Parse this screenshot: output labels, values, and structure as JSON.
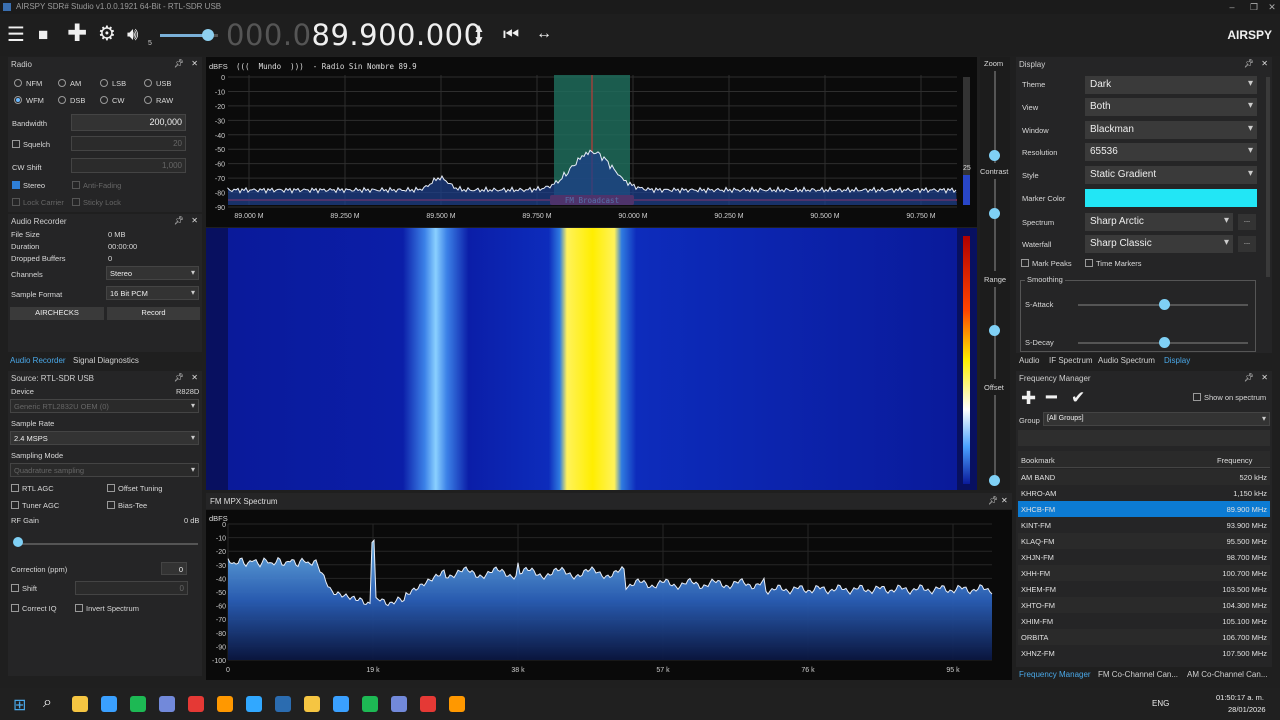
{
  "window": {
    "title": "AIRSPY SDR# Studio v1.0.0.1921 64-Bit - RTL-SDR USB",
    "minimize": "–",
    "maximize": "❐",
    "close": "✕"
  },
  "toolbar": {
    "frequency_dim": "000.0",
    "frequency_bright": "89.900.000",
    "volume_suffix": "5",
    "logo": "AIRSPY"
  },
  "radio": {
    "header": "Radio",
    "modes": [
      "NFM",
      "AM",
      "LSB",
      "USB",
      "WFM",
      "DSB",
      "CW",
      "RAW"
    ],
    "selected_mode": "WFM",
    "bandwidth_label": "Bandwidth",
    "bandwidth_value": "200,000",
    "squelch_label": "Squelch",
    "squelch_value": "20",
    "cw_shift_label": "CW Shift",
    "cw_shift_value": "1,000",
    "stereo_label": "Stereo",
    "anti_fading_label": "Anti-Fading",
    "lock_carrier_label": "Lock Carrier",
    "sticky_lock_label": "Sticky Lock"
  },
  "audio_recorder": {
    "header": "Audio Recorder",
    "file_size_label": "File Size",
    "file_size_value": "0 MB",
    "duration_label": "Duration",
    "duration_value": "00:00:00",
    "dropped_label": "Dropped Buffers",
    "dropped_value": "0",
    "channels_label": "Channels",
    "channels_value": "Stereo",
    "format_label": "Sample Format",
    "format_value": "16 Bit PCM",
    "airchecks_button": "AIRCHECKS",
    "record_button": "Record"
  },
  "left_tabs": {
    "tab1": "Audio Recorder",
    "tab2": "Signal Diagnostics"
  },
  "source": {
    "header": "Source: RTL-SDR USB",
    "device_label": "Device",
    "device_tuner": "R828D",
    "device_value": "Generic RTL2832U OEM (0)",
    "sample_rate_label": "Sample Rate",
    "sample_rate_value": "2.4 MSPS",
    "sampling_mode_label": "Sampling Mode",
    "sampling_mode_value": "Quadrature sampling",
    "rtl_agc": "RTL AGC",
    "offset_tuning": "Offset Tuning",
    "tuner_agc": "Tuner AGC",
    "bias_tee": "Bias-Tee",
    "rf_gain_label": "RF Gain",
    "rf_gain_value": "0 dB",
    "correction_label": "Correction (ppm)",
    "correction_value": "0",
    "shift_label": "Shift",
    "shift_value": "0",
    "correct_iq": "Correct IQ",
    "invert_spectrum": "Invert Spectrum"
  },
  "spectrum": {
    "unit": "dBFS",
    "station_text": "(((  Mundo  )))  - Radio Sin Nombre 89.9",
    "y_ticks": [
      "0",
      "-10",
      "-20",
      "-30",
      "-40",
      "-50",
      "-60",
      "-70",
      "-80",
      "-90"
    ],
    "x_ticks": [
      "89.000 M",
      "89.250 M",
      "89.500 M",
      "89.750 M",
      "90.000 M",
      "90.250 M",
      "90.500 M",
      "90.750 M"
    ],
    "band_label": "FM Broadcast",
    "side_value": "25"
  },
  "side_controls": {
    "zoom": "Zoom",
    "contrast": "Contrast",
    "range": "Range",
    "offset": "Offset"
  },
  "mpx": {
    "header": "FM MPX Spectrum",
    "unit": "dBFS",
    "y_ticks": [
      "0",
      "-10",
      "-20",
      "-30",
      "-40",
      "-50",
      "-60",
      "-70",
      "-80",
      "-90",
      "-100"
    ],
    "x_ticks": [
      "0",
      "19 k",
      "38 k",
      "57 k",
      "76 k",
      "95 k"
    ]
  },
  "display": {
    "header": "Display",
    "theme_label": "Theme",
    "theme_value": "Dark",
    "view_label": "View",
    "view_value": "Both",
    "window_label": "Window",
    "window_value": "Blackman",
    "resolution_label": "Resolution",
    "resolution_value": "65536",
    "style_label": "Style",
    "style_value": "Static Gradient",
    "marker_color_label": "Marker Color",
    "marker_color": "#22e6f5",
    "spectrum_label": "Spectrum",
    "spectrum_value": "Sharp Arctic",
    "waterfall_label": "Waterfall",
    "waterfall_value": "Sharp Classic",
    "mark_peaks": "Mark Peaks",
    "time_markers": "Time Markers",
    "smoothing": "Smoothing",
    "s_attack": "S-Attack",
    "s_decay": "S-Decay",
    "more": "..."
  },
  "right_tabs": {
    "audio": "Audio",
    "if": "IF Spectrum",
    "audio_spectrum": "Audio Spectrum",
    "display": "Display"
  },
  "freq_manager": {
    "header": "Frequency Manager",
    "show_on_spectrum": "Show on spectrum",
    "group_label": "Group",
    "group_value": "[All Groups]",
    "col_bookmark": "Bookmark",
    "col_frequency": "Frequency",
    "rows": [
      {
        "name": "AM BAND",
        "freq": "520 kHz"
      },
      {
        "name": "KHRO-AM",
        "freq": "1,150 kHz"
      },
      {
        "name": "XHCB-FM",
        "freq": "89.900 MHz"
      },
      {
        "name": "KINT-FM",
        "freq": "93.900 MHz"
      },
      {
        "name": "KLAQ-FM",
        "freq": "95.500 MHz"
      },
      {
        "name": "XHJN-FM",
        "freq": "98.700 MHz"
      },
      {
        "name": "XHH-FM",
        "freq": "100.700 MHz"
      },
      {
        "name": "XHEM-FM",
        "freq": "103.500 MHz"
      },
      {
        "name": "XHTO-FM",
        "freq": "104.300 MHz"
      },
      {
        "name": "XHIM-FM",
        "freq": "105.100 MHz"
      },
      {
        "name": "ORBITA",
        "freq": "106.700 MHz"
      },
      {
        "name": "XHNZ-FM",
        "freq": "107.500 MHz"
      }
    ],
    "selected_index": 2
  },
  "bottom_tabs": {
    "t1": "Frequency Manager",
    "t2": "FM Co-Channel Can...",
    "t3": "AM Co-Channel Can..."
  },
  "taskbar": {
    "lang": "ENG",
    "time": "01:50:17 a. m.",
    "date": "28/01/2026",
    "app_colors": [
      "#f5c542",
      "#3aa0ff",
      "#1db954",
      "#7289da",
      "#e53935",
      "#ff9800",
      "#31a8ff",
      "#2b6cb0"
    ]
  }
}
